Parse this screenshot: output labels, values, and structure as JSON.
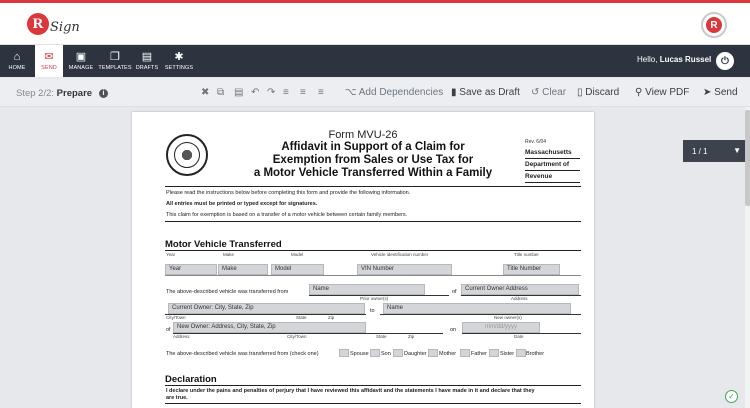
{
  "brand": {
    "name": "RSign",
    "logo_letter": "R",
    "logo_tail": "Sign",
    "badge_letter": "R",
    "accent": "#d9383d",
    "nav_bg": "#2d3440"
  },
  "nav": {
    "items": [
      {
        "icon": "home-icon",
        "glyph": "⌂",
        "label": "HOME"
      },
      {
        "icon": "send-icon",
        "glyph": "✉",
        "label": "SEND"
      },
      {
        "icon": "manage-icon",
        "glyph": "▣",
        "label": "MANAGE"
      },
      {
        "icon": "templates-icon",
        "glyph": "❐",
        "label": "TEMPLATES"
      },
      {
        "icon": "drafts-icon",
        "glyph": "▤",
        "label": "DRAFTS"
      },
      {
        "icon": "settings-icon",
        "glyph": "✱",
        "label": "SETTINGS"
      }
    ],
    "hello_prefix": "Hello, ",
    "user_name": "Lucas Russel"
  },
  "toolbar": {
    "step": "Step 2/2:",
    "step_name": "Prepare",
    "add_dependencies": "Add Dependencies",
    "save_as_draft": "Save as Draft",
    "clear": "Clear",
    "discard": "Discard",
    "view_pdf": "View PDF",
    "send": "Send"
  },
  "pager": {
    "label": "1 / 1"
  },
  "document": {
    "form_no": "Form MVU-26",
    "title_line1": "Affidavit in Support of a Claim for",
    "title_line2": "Exemption from Sales or Use Tax for",
    "title_line3": "a Motor Vehicle Transferred Within a Family",
    "rev": "Rev. 6/04",
    "dept1": "Massachusetts",
    "dept2": "Department of",
    "dept3": "Revenue",
    "instr1": "Please read the instructions below before completing this form and provide the following information.",
    "instr2": "All entries must be printed or typed except for signatures.",
    "instr3": "This claim for exemption is based on a transfer of a motor vehicle between certain family members.",
    "section1": "Motor Vehicle Transferred",
    "col_year": "Year",
    "col_make": "Make",
    "col_model": "Model",
    "col_vin": "Vehicle identification number",
    "col_title": "Title number",
    "f_year": "Year",
    "f_make": "Make",
    "f_model": "Model",
    "f_vin": "VIN Number",
    "f_title": "Title Number",
    "transferred_from": "The above-described vehicle was transferred from",
    "f_name": "Name",
    "of": "of",
    "f_current_address": "Current Owner Address",
    "lbl_prior_owner": "Prior owner(s)",
    "lbl_address": "Address",
    "f_current_owner": "Current Owner: City, State, Zip",
    "to": "to",
    "f_name2": "Name",
    "lbl_city": "City/Town",
    "lbl_state": "State",
    "lbl_zip": "Zip",
    "lbl_new_owner": "New owner(s)",
    "of2": "of",
    "f_new_owner": "New Owner: Address, City, State, Zip",
    "on": "on",
    "f_date": "mm/dd/yyyy",
    "lbl_address2": "Address",
    "lbl_city2": "City/Town",
    "lbl_state2": "State",
    "lbl_zip2": "Zip",
    "lbl_date": "Date",
    "check_one": "The above-described vehicle was transferred from (check one)",
    "rel_spouse": "Spouse",
    "rel_son": "Son",
    "rel_daughter": "Daughter",
    "rel_mother": "Mother",
    "rel_father": "Father",
    "rel_sister": "Sister",
    "rel_brother": "Brother",
    "section2": "Declaration",
    "declaration": "I declare under the pains and penalties of perjury that I have reviewed this affidavit and the statements I have made in it and declare that they",
    "declaration2": "are true."
  }
}
